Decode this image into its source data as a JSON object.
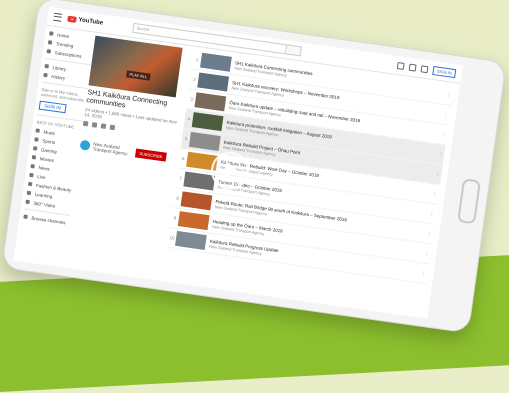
{
  "header": {
    "logo_text": "YouTube",
    "search_placeholder": "Search",
    "sign_in_label": "SIGN IN"
  },
  "sidebar": {
    "items": [
      {
        "label": "Home"
      },
      {
        "label": "Trending"
      },
      {
        "label": "Subscriptions"
      },
      {
        "label": "Library"
      },
      {
        "label": "History"
      }
    ],
    "signin_prompt": "Sign in to like videos, comment, and subscribe.",
    "signin_label": "SIGN IN",
    "best_heading": "BEST OF YOUTUBE",
    "best_items": [
      {
        "label": "Music"
      },
      {
        "label": "Sports"
      },
      {
        "label": "Gaming"
      },
      {
        "label": "Movies"
      },
      {
        "label": "News"
      },
      {
        "label": "Live"
      },
      {
        "label": "Fashion & Beauty"
      },
      {
        "label": "Learning"
      },
      {
        "label": "360° Video"
      }
    ],
    "browse_label": "Browse channels"
  },
  "playlist": {
    "play_all": "PLAY ALL",
    "title": "SH1 Kaikōura Connecting communities",
    "meta": "24 videos • 1,946 views • Last updated on Nov 14, 2019",
    "owner": "New Zealand Transport Agency",
    "subscribe": "SUBSCRIBE"
  },
  "videos": [
    {
      "n": "1",
      "title": "SH1 Kaikōura Connecting communities",
      "sub": "New Zealand Transport Agency",
      "color": "#6b7c8f"
    },
    {
      "n": "2",
      "title": "SH1 Kaikōura recovery: Workshops – November 2019",
      "sub": "New Zealand Transport Agency",
      "color": "#5a6e7e"
    },
    {
      "n": "3",
      "title": "Ōaro Kaikōura update – rebuilding road and rail – November 2019",
      "sub": "New Zealand Transport Agency",
      "color": "#7a6a5a"
    },
    {
      "n": "4",
      "title": "Kaikōura protection: rockfall mitigation – August 2019",
      "sub": "New Zealand Transport Agency",
      "color": "#4c5d3e"
    },
    {
      "n": "5",
      "title": "Kaikōura Rebuild Project – Ōhau Point",
      "sub": "New Zealand Transport Agency",
      "color": "#8d8d8d"
    },
    {
      "n": "6",
      "title": "Kaikōura SH1 Rebuild: Work Day – October 2019",
      "sub": "New Zealand Transport Agency",
      "color": "#d08a2a"
    },
    {
      "n": "7",
      "title": "Tunnel 15 video – October 2019",
      "sub": "New Zealand Transport Agency",
      "color": "#6f6f6f"
    },
    {
      "n": "8",
      "title": "Peketā Route: Rail Bridge 90 south of Kaikōura – September 2019",
      "sub": "New Zealand Transport Agency",
      "color": "#b7552a"
    },
    {
      "n": "9",
      "title": "Heading up the Ōaro – March 2019",
      "sub": "New Zealand Transport Agency",
      "color": "#c76a2c"
    },
    {
      "n": "10",
      "title": "Kaikōura Rebuild Progress Update",
      "sub": "New Zealand Transport Agency",
      "color": "#7e8a94"
    }
  ]
}
